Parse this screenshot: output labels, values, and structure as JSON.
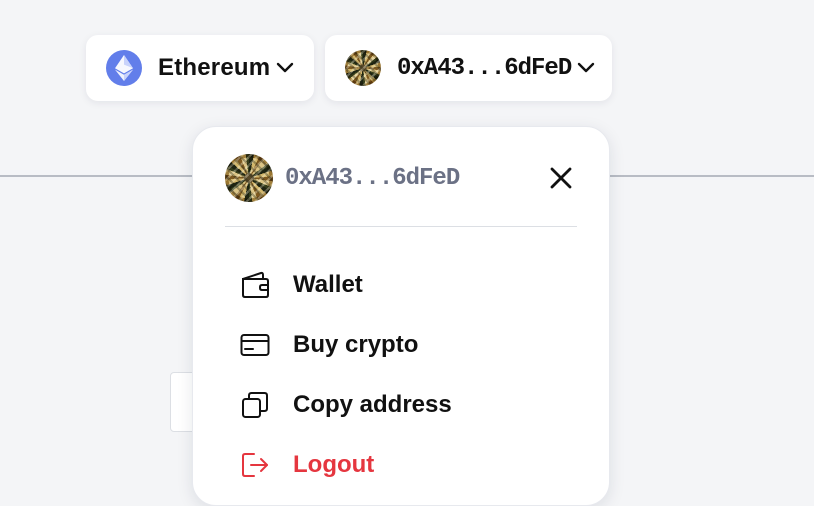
{
  "network": {
    "label": "Ethereum",
    "icon": "ethereum-icon",
    "chevron_icon": "chevron-down-icon",
    "brand_color": "#627eea"
  },
  "account": {
    "address_short": "0xA43...6dFeD",
    "avatar_icon": "identicon-avatar",
    "chevron_icon": "chevron-down-icon"
  },
  "dropdown": {
    "address_short": "0xA43...6dFeD",
    "close_icon": "close-icon",
    "items": [
      {
        "label": "Wallet",
        "icon": "wallet-icon"
      },
      {
        "label": "Buy crypto",
        "icon": "credit-card-icon"
      },
      {
        "label": "Copy address",
        "icon": "copy-icon"
      },
      {
        "label": "Logout",
        "icon": "logout-icon",
        "color": "#e5363f"
      }
    ]
  },
  "colors": {
    "background": "#f4f5f7",
    "surface": "#ffffff",
    "muted_text": "#6b7185",
    "danger": "#e5363f"
  }
}
